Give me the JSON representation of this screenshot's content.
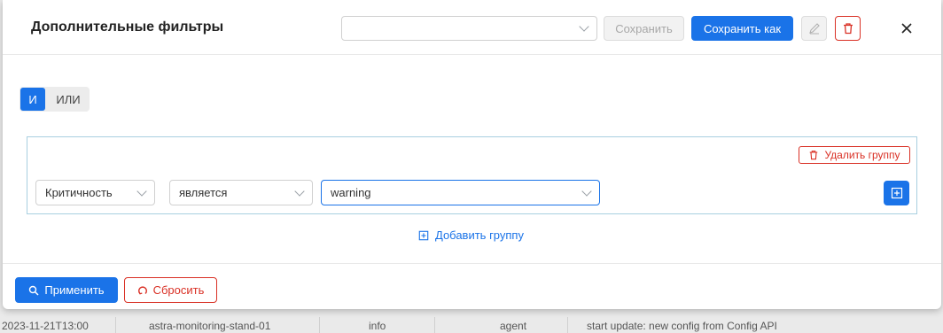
{
  "background": {
    "row_cells": [
      "2023-11-21T13:00",
      "astra-monitoring-stand-01",
      "info",
      "agent",
      "start update: new config from Config API"
    ]
  },
  "modal": {
    "title": "Дополнительные фильтры",
    "preset_select": {
      "value": ""
    },
    "save_label": "Сохранить",
    "save_as_label": "Сохранить как"
  },
  "logic_toggle": {
    "and_label": "И",
    "or_label": "ИЛИ",
    "selected": "И"
  },
  "group": {
    "delete_label": "Удалить группу",
    "condition": {
      "field": "Критичность",
      "operator": "является",
      "value": "warning"
    }
  },
  "add_group_label": "Добавить группу",
  "footer": {
    "apply_label": "Применить",
    "reset_label": "Сбросить"
  },
  "colors": {
    "primary": "#1a73e8",
    "danger": "#d93025",
    "group_border": "#a8cfe0"
  },
  "icons": [
    "chevron-down-icon",
    "pencil-icon",
    "trash-icon",
    "close-icon",
    "plus-square-icon",
    "search-icon",
    "reset-icon"
  ]
}
